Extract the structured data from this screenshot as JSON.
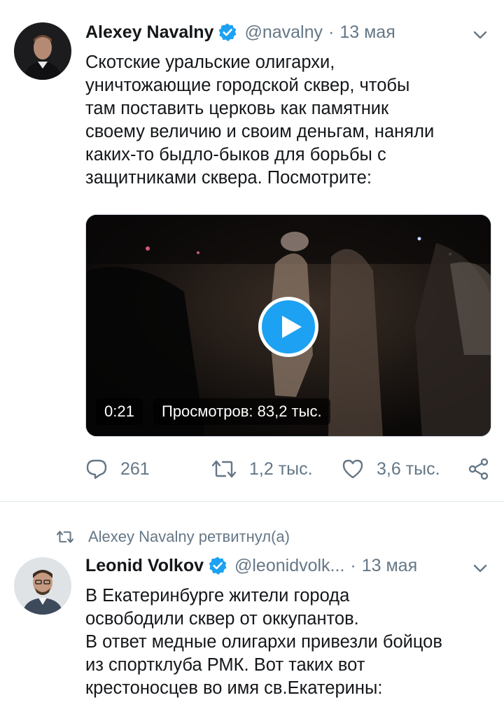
{
  "tweet1": {
    "author_name": "Alexey Navalny",
    "handle": "@navalny",
    "separator": "·",
    "time": "13 мая",
    "text_lines": [
      "Скотские уральские олигархи,",
      "уничтожающие городской сквер, чтобы",
      "там поставить церковь как памятник",
      "своему величию и своим деньгам, наняли",
      "каких-то быдло-быков для борьбы с",
      "защитниками сквера. Посмотрите:"
    ],
    "video": {
      "duration": "0:21",
      "views": "Просмотров: 83,2 тыс."
    },
    "actions": {
      "replies": "261",
      "retweets": "1,2 тыс.",
      "likes": "3,6 тыс."
    }
  },
  "retweet_context": "Alexey Navalny ретвитнул(а)",
  "tweet2": {
    "author_name": "Leonid Volkov",
    "handle": "@leonidvolk...",
    "separator": "·",
    "time": "13 мая",
    "text_lines": [
      "В Екатеринбурге жители города",
      "освободили сквер от оккупантов.",
      "В ответ медные олигархи привезли бойцов",
      "из спортклуба РМК. Вот таких вот",
      "крестоносцев во имя св.Екатерины:"
    ]
  },
  "colors": {
    "accent": "#1da1f2",
    "secondary_text": "#657786",
    "primary_text": "#14171a",
    "divider": "#e1e8ed"
  },
  "icons": {
    "verified": "verified-badge-icon",
    "caret": "chevron-down-icon",
    "reply": "reply-icon",
    "retweet": "retweet-icon",
    "like": "heart-icon",
    "share": "share-icon",
    "play": "play-icon"
  }
}
